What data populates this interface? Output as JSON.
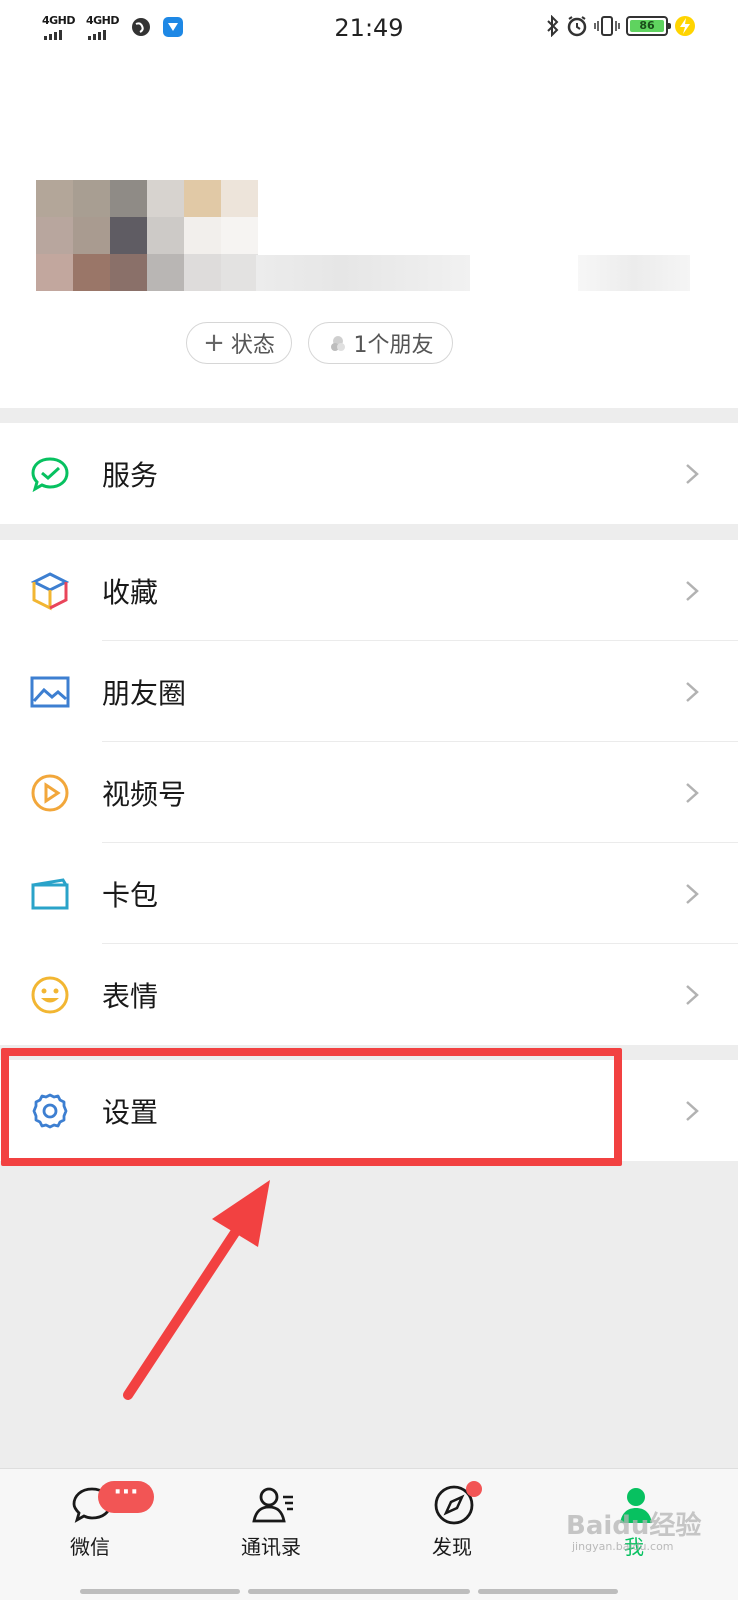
{
  "status_bar": {
    "signal_1": "4GHD",
    "signal_2": "4GHD",
    "time": "21:49",
    "battery": "86"
  },
  "profile": {
    "status_chip": "状态",
    "friends_chip": "1个朋友"
  },
  "menu": {
    "services": "服务",
    "favorites": "收藏",
    "moments": "朋友圈",
    "channels": "视频号",
    "cards": "卡包",
    "stickers": "表情",
    "settings": "设置"
  },
  "tabbar": {
    "chats": "微信",
    "chats_badge": "···",
    "contacts": "通讯录",
    "discover": "发现",
    "me": "我"
  },
  "watermark": {
    "brand": "Baidu经验",
    "url": "jingyan.baidu.com"
  },
  "colors": {
    "wechat_green": "#07c160",
    "highlight_red": "#f24141",
    "badge_red": "#f25555"
  }
}
